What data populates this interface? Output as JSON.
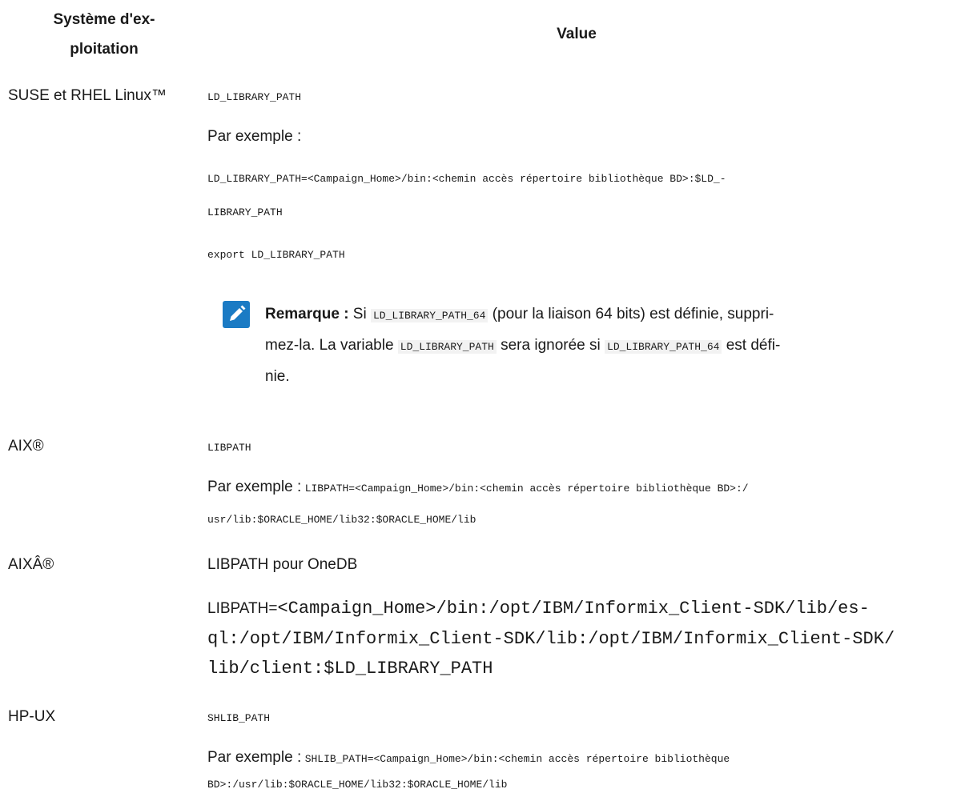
{
  "table": {
    "header_os_line1": "Système d'ex-",
    "header_os_line2": "ploitation",
    "header_value": "Value"
  },
  "rows": {
    "suse": {
      "os": "SUSE et RHEL Linux™",
      "var": "LD_LIBRARY_PATH",
      "example_label": "Par exemple :",
      "code_line1": "LD_LIBRARY_PATH=<Campaign_Home>/bin:<chemin accès répertoire bibliothèque BD>:$LD_-",
      "code_line2": "LIBRARY_PATH",
      "code_line3": "export LD_LIBRARY_PATH",
      "note": {
        "label": "Remarque :",
        "t1": " Si ",
        "c1": "LD_LIBRARY_PATH_64",
        "t2": " (pour la liaison 64 bits) est définie, suppri-",
        "t3": "mez-la. La variable ",
        "c2": "LD_LIBRARY_PATH",
        "t4": " sera ignorée si ",
        "c3": "LD_LIBRARY_PATH_64",
        "t5": " est défi-",
        "t6": "nie."
      }
    },
    "aix": {
      "os": "AIX®",
      "var": "LIBPATH",
      "example_label": "Par exemple :",
      "code_line1": "LIBPATH=<Campaign_Home>/bin:<chemin accès répertoire bibliothèque BD>:/",
      "code_line2": "usr/lib:$ORACLE_HOME/lib32:$ORACLE_HOME/lib"
    },
    "aix_onedb": {
      "os": "AIXÂ®",
      "title": "LIBPATH pour OneDB",
      "prefix": "LIBPATH=",
      "code_line1": "<Campaign_Home>/bin:/opt/IBM/Informix_Client-SDK/lib/es-",
      "code_line2": "ql:/opt/IBM/Informix_Client-SDK/lib:/opt/IBM/Informix_Client-SDK/",
      "code_line3": "lib/client:$LD_LIBRARY_PATH"
    },
    "hpux": {
      "os": "HP-UX",
      "var": "SHLIB_PATH",
      "example_label": "Par exemple :",
      "code_line1": "SHLIB_PATH=<Campaign_Home>/bin:<chemin accès répertoire bibliothèque",
      "code_line2": "BD>:/usr/lib:$ORACLE_HOME/lib32:$ORACLE_HOME/lib"
    }
  }
}
